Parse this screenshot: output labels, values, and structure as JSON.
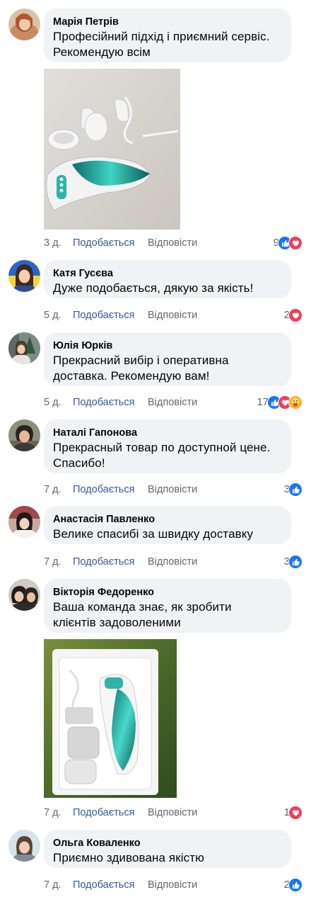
{
  "comments": [
    {
      "author": "Марія Петрів",
      "lines": [
        "Професійний підхід і приємний сервіс.",
        "Рекомендую всім"
      ],
      "time": "3 д.",
      "like_label": "Подобається",
      "reply_label": "Відповісти",
      "reaction_count": "9",
      "reactions": [
        "like-icon",
        "love-icon"
      ],
      "has_photo": true
    },
    {
      "author": "Катя Гусєва",
      "lines": [
        "Дуже подобається, дякую за якість!"
      ],
      "time": "5 д.",
      "like_label": "Подобається",
      "reply_label": "Відповісти",
      "reaction_count": "2",
      "reactions": [
        "love-icon"
      ]
    },
    {
      "author": "Юлія Юрків",
      "lines": [
        "Прекрасний вибір і оперативна",
        "доставка. Рекомендую вам!"
      ],
      "time": "5 д.",
      "like_label": "Подобається",
      "reply_label": "Відповісти",
      "reaction_count": "17",
      "reactions": [
        "like-icon",
        "love-icon",
        "care-icon"
      ]
    },
    {
      "author": "Наталі Гапонова",
      "lines": [
        "Прекрасный товар по доступной цене.",
        "Спасибо!"
      ],
      "time": "7 д.",
      "like_label": "Подобається",
      "reply_label": "Відповісти",
      "reaction_count": "3",
      "reactions": [
        "like-icon"
      ]
    },
    {
      "author": "Анастасія Павленко",
      "lines": [
        "Велике спасибі за швидку доставку"
      ],
      "time": "7 д.",
      "like_label": "Подобається",
      "reply_label": "Відповісти",
      "reaction_count": "3",
      "reactions": [
        "like-icon"
      ]
    },
    {
      "author": "Вікторія Федоренко",
      "lines": [
        "Ваша команда знає, як зробити",
        "клієнтів задоволеними"
      ],
      "time": "7 д.",
      "like_label": "Подобається",
      "reply_label": "Відповісти",
      "reaction_count": "1",
      "reactions": [
        "love-icon"
      ],
      "has_photo": true
    },
    {
      "author": "Ольга Коваленко",
      "lines": [
        "Приємно здивована якістю"
      ],
      "time": "7 д.",
      "like_label": "Подобається",
      "reply_label": "Відповісти",
      "reaction_count": "2",
      "reactions": [
        "like-icon"
      ]
    }
  ],
  "colors": {
    "bubble": "#f0f2f5",
    "link": "#385898",
    "muted": "#65676b",
    "like": "#1877f2",
    "love": "#f33e58",
    "care": "#f7b125"
  }
}
